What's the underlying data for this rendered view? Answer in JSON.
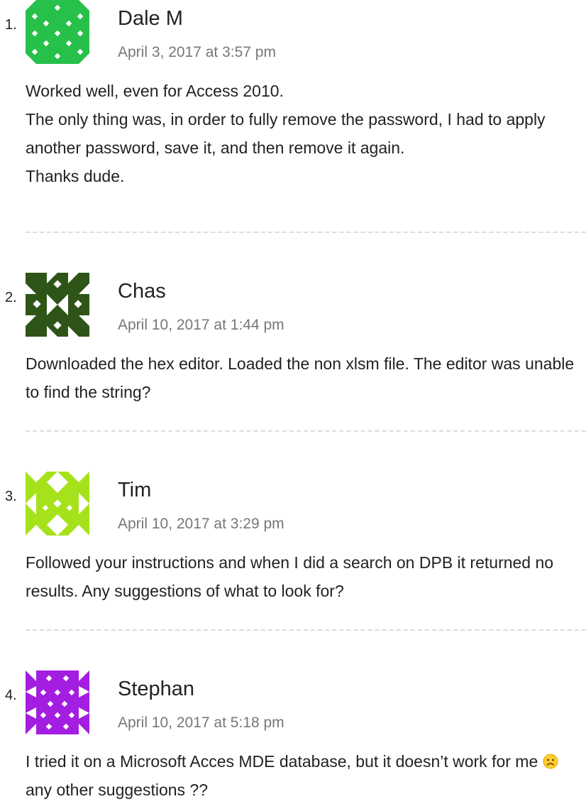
{
  "comments": [
    {
      "number": "1.",
      "author": "Dale M",
      "date": "April 3, 2017 at 3:57 pm",
      "avatar_color": "#27c04a",
      "lines": [
        "Worked well, even for Access 2010.",
        "The only thing was, in order to fully remove the password, I had to apply another password, save it, and then remove it again.",
        "Thanks dude."
      ]
    },
    {
      "number": "2.",
      "author": "Chas",
      "date": "April 10, 2017 at 1:44 pm",
      "avatar_color": "#2f5418",
      "lines": [
        "Downloaded the hex editor. Loaded the non xlsm file. The editor was unable to find the string?"
      ]
    },
    {
      "number": "3.",
      "author": "Tim",
      "date": "April 10, 2017 at 3:29 pm",
      "avatar_color": "#a6e21c",
      "lines": [
        "Followed your instructions and when I did a search on DPB it returned no results. Any suggestions of what to look for?"
      ]
    },
    {
      "number": "4.",
      "author": "Stephan",
      "date": "April 10, 2017 at 5:18 pm",
      "avatar_color": "#a31ee0",
      "lines_before_emoji": "I tried it on a Microsoft Acces MDE database, but it doesn’t work for me",
      "emoji": "slightly-frowning-face",
      "lines_after_emoji": "any other suggestions ??"
    }
  ]
}
